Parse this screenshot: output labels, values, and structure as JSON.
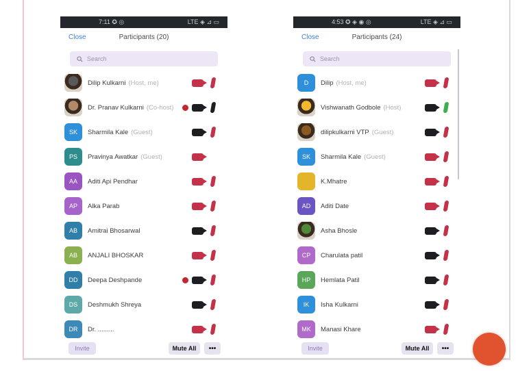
{
  "colors": {
    "mute_red": "#c33248",
    "muted_dark": "#1e1e22",
    "unmuted_green": "#3fae4c",
    "raise_hand": "#c2262e",
    "fab": "#e0532e"
  },
  "left": {
    "status": {
      "left": "7:11 ✪ ◎",
      "right": "LTE ◈ ⊿ ▭"
    },
    "close_label": "Close",
    "title": "Participants (20)",
    "search_placeholder": "Search",
    "participants": [
      {
        "name": "Dilip Kulkarni",
        "role": "(Host, me)",
        "avatar_text": "",
        "avatar_color": "#5a5a5a",
        "photo": true,
        "raised": false,
        "video_muted": true,
        "mic": "red"
      },
      {
        "name": "Dr. Pranav Kulkarni",
        "role": "(Co-host)",
        "avatar_text": "",
        "avatar_color": "#b08a6a",
        "photo": true,
        "raised": true,
        "video_muted": false,
        "mic": "dark"
      },
      {
        "name": "Sharmila Kale",
        "role": "(Guest)",
        "avatar_text": "SK",
        "avatar_color": "#2f8fd9",
        "photo": false,
        "raised": false,
        "video_muted": false,
        "mic": "red"
      },
      {
        "name": "Pravinya Awatkar",
        "role": "(Guest)",
        "avatar_text": "PS",
        "avatar_color": "#2f8c8c",
        "photo": false,
        "raised": false,
        "video_muted": true,
        "mic": "none"
      },
      {
        "name": "Aditi Api Pendhar",
        "role": "",
        "avatar_text": "AA",
        "avatar_color": "#9b55c2",
        "photo": false,
        "raised": false,
        "video_muted": true,
        "mic": "red"
      },
      {
        "name": "Alka Parab",
        "role": "",
        "avatar_text": "AP",
        "avatar_color": "#a663c9",
        "photo": false,
        "raised": false,
        "video_muted": true,
        "mic": "red"
      },
      {
        "name": "Amitrai Bhosarwal",
        "role": "",
        "avatar_text": "AB",
        "avatar_color": "#2f7fa8",
        "photo": false,
        "raised": false,
        "video_muted": false,
        "mic": "red"
      },
      {
        "name": "ANJALI BHOSKAR",
        "role": "",
        "avatar_text": "AB",
        "avatar_color": "#8bb04f",
        "photo": false,
        "raised": false,
        "video_muted": true,
        "mic": "red"
      },
      {
        "name": "Deepa Deshpande",
        "role": "",
        "avatar_text": "DD",
        "avatar_color": "#2f7fa8",
        "photo": false,
        "raised": true,
        "video_muted": false,
        "mic": "red"
      },
      {
        "name": "Deshmukh Shreya",
        "role": "",
        "avatar_text": "DS",
        "avatar_color": "#5ea8a8",
        "photo": false,
        "raised": false,
        "video_muted": false,
        "mic": "red"
      },
      {
        "name": "Dr. .........",
        "role": "",
        "avatar_text": "DR",
        "avatar_color": "#3d8ab8",
        "photo": false,
        "raised": false,
        "video_muted": true,
        "mic": "red"
      }
    ],
    "invite_label": "Invite",
    "mute_all_label": "Mute All",
    "more_label": "•••"
  },
  "right": {
    "status": {
      "left": "4:53 ✪ ◈ ◉ ◎",
      "right": "LTE ◈ ⊿ ▭"
    },
    "close_label": "Close",
    "title": "Participants (24)",
    "search_placeholder": "Search",
    "participants": [
      {
        "name": "Dilip",
        "role": "(Host, me)",
        "avatar_text": "D",
        "avatar_color": "#2f8fd9",
        "photo": false,
        "raised": false,
        "video_muted": true,
        "mic": "red"
      },
      {
        "name": "Vishwanath Godbole",
        "role": "(Host)",
        "avatar_text": "",
        "avatar_color": "#f2b830",
        "photo": true,
        "raised": false,
        "video_muted": false,
        "mic": "green"
      },
      {
        "name": "dilipkulkarni VTP",
        "role": "(Guest)",
        "avatar_text": "",
        "avatar_color": "#8a5a1e",
        "photo": true,
        "raised": false,
        "video_muted": false,
        "mic": "red"
      },
      {
        "name": "Sharmila Kale",
        "role": "(Guest)",
        "avatar_text": "SK",
        "avatar_color": "#2f8fd9",
        "photo": false,
        "raised": false,
        "video_muted": true,
        "mic": "red"
      },
      {
        "name": "K.Mhatre",
        "role": "",
        "avatar_text": "",
        "avatar_color": "#e2b52a",
        "photo": false,
        "raised": false,
        "video_muted": true,
        "mic": "red"
      },
      {
        "name": "Aditi Date",
        "role": "",
        "avatar_text": "AD",
        "avatar_color": "#6a55c2",
        "photo": false,
        "raised": false,
        "video_muted": true,
        "mic": "red"
      },
      {
        "name": "Asha Bhosle",
        "role": "",
        "avatar_text": "",
        "avatar_color": "#4f8a3a",
        "photo": true,
        "raised": false,
        "video_muted": false,
        "mic": "red"
      },
      {
        "name": "Charulata patil",
        "role": "",
        "avatar_text": "CP",
        "avatar_color": "#b06ac9",
        "photo": false,
        "raised": false,
        "video_muted": false,
        "mic": "red"
      },
      {
        "name": "Hemlata Patil",
        "role": "",
        "avatar_text": "HP",
        "avatar_color": "#5aa65a",
        "photo": false,
        "raised": false,
        "video_muted": false,
        "mic": "red"
      },
      {
        "name": "Isha Kulkarni",
        "role": "",
        "avatar_text": "IK",
        "avatar_color": "#2f8fd9",
        "photo": false,
        "raised": false,
        "video_muted": false,
        "mic": "red"
      },
      {
        "name": "Manasi Khare",
        "role": "",
        "avatar_text": "MK",
        "avatar_color": "#b06ac9",
        "photo": false,
        "raised": false,
        "video_muted": true,
        "mic": "red"
      }
    ],
    "invite_label": "Invite",
    "mute_all_label": "Mute All",
    "more_label": "•••"
  }
}
